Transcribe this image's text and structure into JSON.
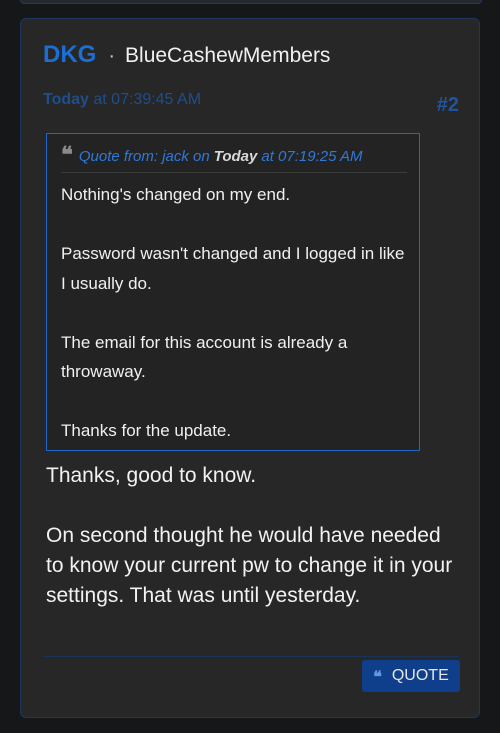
{
  "post": {
    "author": "DKG",
    "separator": "·",
    "group": "BlueCashewMembers",
    "date_day": "Today",
    "date_time": " at 07:39:45 AM",
    "number": "#2",
    "quote": {
      "icon": "quote-icon",
      "prefix": "Quote from: jack on",
      "day": "Today",
      "time": "at 07:19:25 AM",
      "paragraphs": [
        "Nothing's changed on my end.",
        "Password wasn't changed and I logged in like I usually do.",
        "The email for this account is already a throwaway.",
        "Thanks for the update."
      ]
    },
    "reply_paragraphs": [
      "Thanks, good to know.",
      "On second thought he would have needed to know your current pw to change it in your settings. That was until yesterday."
    ],
    "quote_button": {
      "icon": "quote-icon",
      "label": "QUOTE"
    }
  },
  "colors": {
    "accent": "#1b6ed6",
    "background": "#161719",
    "card": "#272727",
    "button": "#0f3f8a"
  }
}
